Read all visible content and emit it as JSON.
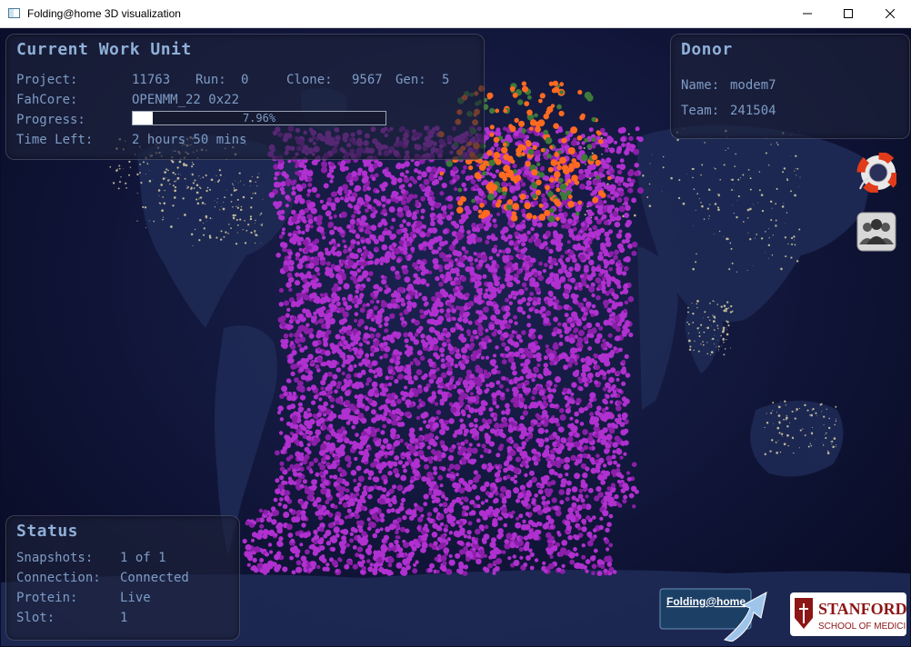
{
  "window": {
    "title": "Folding@home 3D visualization",
    "controls": [
      "minimize",
      "maximize",
      "close"
    ]
  },
  "work_unit": {
    "heading": "Current Work Unit",
    "project_label": "Project:",
    "project": "11763",
    "run_label": "Run:",
    "run": "0",
    "clone_label": "Clone:",
    "clone": "9567",
    "gen_label": "Gen:",
    "gen": "5",
    "fahcore_label": "FahCore:",
    "fahcore": "OPENMM_22 0x22",
    "progress_label": "Progress:",
    "progress_text": "7.96%",
    "progress_fraction": 0.0796,
    "time_left_label": "Time Left:",
    "time_left": "2 hours 50 mins"
  },
  "donor": {
    "heading": "Donor",
    "name_label": "Name:",
    "name": "modem7",
    "team_label": "Team:",
    "team": "241504"
  },
  "status": {
    "heading": "Status",
    "snapshots_label": "Snapshots:",
    "snapshots": "1 of 1",
    "connection_label": "Connection:",
    "connection": "Connected",
    "protein_label": "Protein:",
    "protein": "Live",
    "slot_label": "Slot:",
    "slot": "1"
  },
  "side_buttons": {
    "help_icon": "lifebuoy-icon",
    "community_icon": "people-icon"
  },
  "logos": {
    "fah": "Folding@home",
    "stanford_top": "STANFORD",
    "stanford_bottom": "SCHOOL OF MEDICINE"
  },
  "colors": {
    "panel_text": "#7e9cc6",
    "heading_text": "#8fb0d8",
    "atom_purple": "#b030d0",
    "atom_orange": "#ff6a20",
    "stanford_red": "#8c1515"
  }
}
